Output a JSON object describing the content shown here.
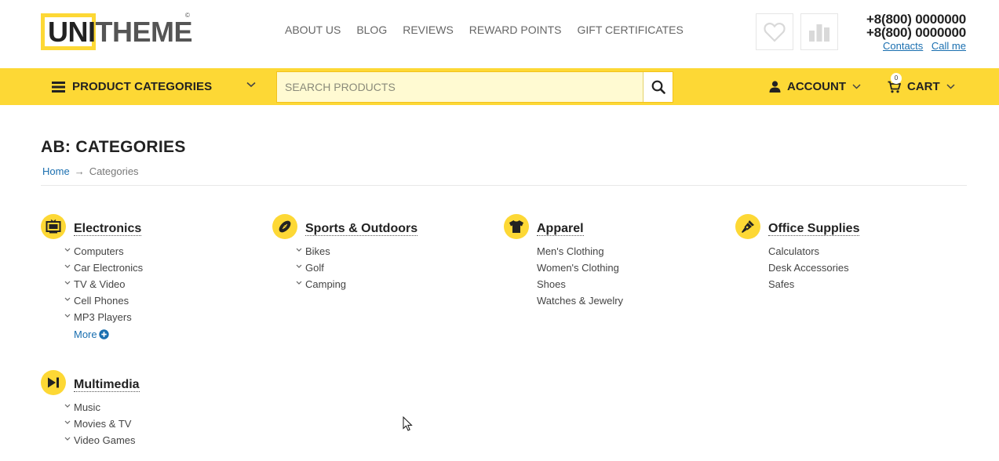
{
  "brand": {
    "logo_boxed": "UNI",
    "logo_rest": "THEME",
    "copyright": "©"
  },
  "topnav": [
    "ABOUT US",
    "BLOG",
    "REVIEWS",
    "REWARD POINTS",
    "GIFT CERTIFICATES"
  ],
  "contact": {
    "phone1": "+8(800) 0000000",
    "phone2": "+8(800) 0000000",
    "contacts_link": "Contacts",
    "callme_link": "Call me"
  },
  "bar": {
    "categories_label": "PRODUCT CATEGORIES",
    "search_placeholder": "SEARCH PRODUCTS",
    "account_label": "ACCOUNT",
    "cart_label": "CART",
    "cart_count": "0"
  },
  "page": {
    "title": "AB: CATEGORIES",
    "breadcrumb_home": "Home",
    "breadcrumb_sep": "→",
    "breadcrumb_current": "Categories"
  },
  "categories": [
    {
      "title": "Electronics",
      "icon": "tv-icon",
      "items": [
        "Computers",
        "Car Electronics",
        "TV & Video",
        "Cell Phones",
        "MP3 Players"
      ],
      "more": "More"
    },
    {
      "title": "Sports & Outdoors",
      "icon": "football-icon",
      "items": [
        "Bikes",
        "Golf",
        "Camping"
      ]
    },
    {
      "title": "Apparel",
      "icon": "tshirt-icon",
      "items": [
        "Men's Clothing",
        "Women's Clothing",
        "Shoes",
        "Watches & Jewelry"
      ]
    },
    {
      "title": "Office Supplies",
      "icon": "pen-icon",
      "items": [
        "Calculators",
        "Desk Accessories",
        "Safes"
      ]
    },
    {
      "title": "Multimedia",
      "icon": "play-skip-icon",
      "items": [
        "Music",
        "Movies & TV",
        "Video Games"
      ]
    }
  ],
  "colors": {
    "accent": "#fdd835",
    "link": "#1a6fb0",
    "text": "#222222"
  }
}
